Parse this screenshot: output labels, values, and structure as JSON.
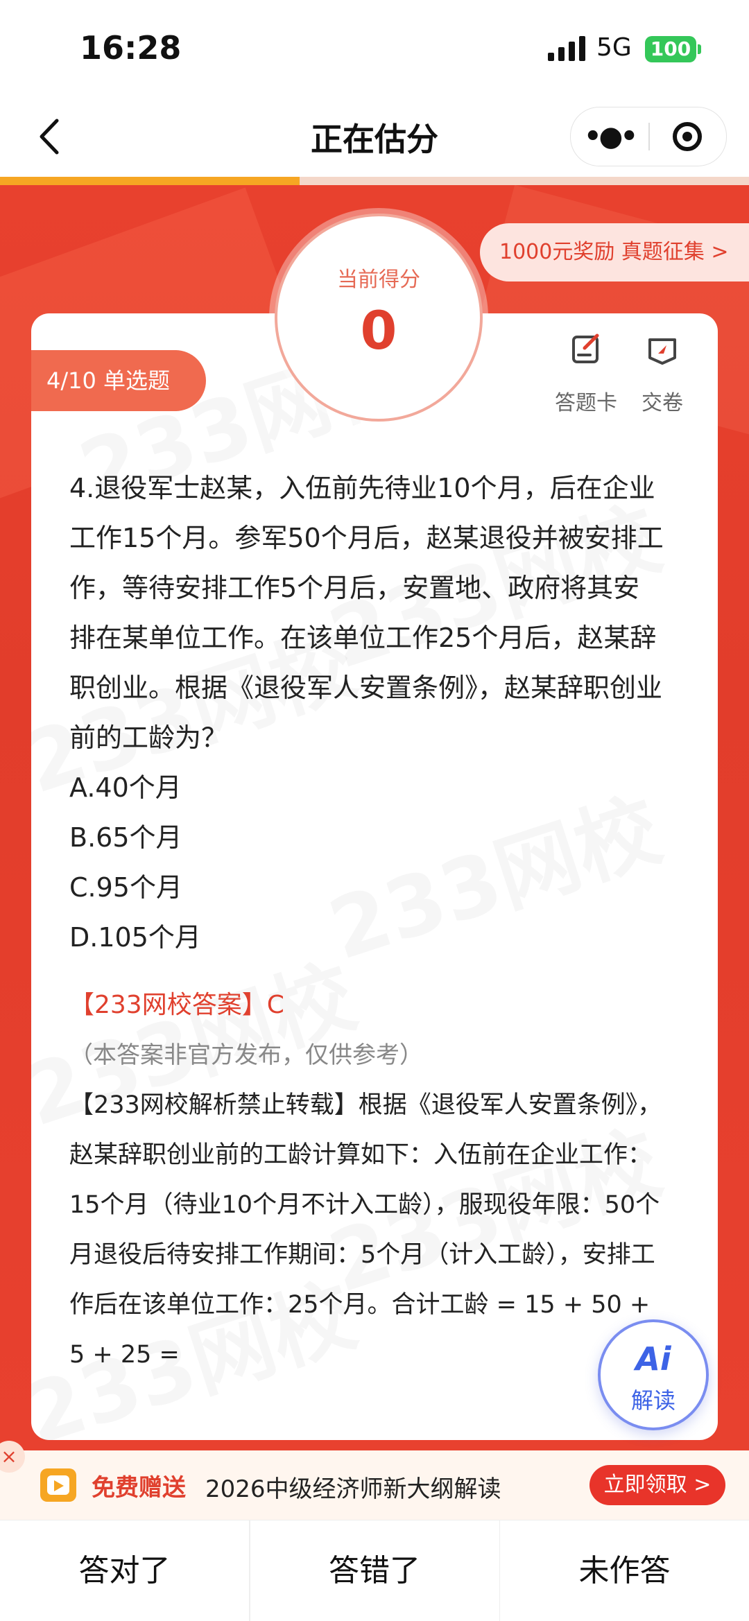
{
  "status_bar": {
    "time": "16:28",
    "network": "5G",
    "battery": "100"
  },
  "nav": {
    "title": "正在估分"
  },
  "progress": {
    "fraction": 0.4
  },
  "reward_banner": "1000元奖励 真题征集 >",
  "question_tag": "4/10 单选题",
  "score": {
    "label": "当前得分",
    "value": "0"
  },
  "tools": [
    {
      "icon": "answer-sheet-icon",
      "label": "答题卡"
    },
    {
      "icon": "submit-icon",
      "label": "交卷"
    }
  ],
  "question": {
    "text": "4.退役军士赵某，入伍前先待业10个月，后在企业工作15个月。参军50个月后，赵某退役并被安排工作，等待安排工作5个月后，安置地、政府将其安排在某单位工作。在该单位工作25个月后，赵某辞职创业。根据《退役军人安置条例》，赵某辞职创业前的工龄为？",
    "options": [
      "A.40个月",
      "B.65个月",
      "C.95个月",
      "D.105个月"
    ],
    "answer": "【233网校答案】C",
    "disclaimer": "（本答案非官方发布，仅供参考）",
    "analysis": "【233网校解析禁止转载】根据《退役军人安置条例》，赵某辞职创业前的工龄计算如下：入伍前在企业工作：15个月（待业10个月不计入工龄），服现役年限：50个月退役后待安排工作期间：5个月（计入工龄），安排工作后在该单位工作：25个月。合计工龄 = 15 + 50 + 5 + 25 ="
  },
  "watermark": "233网校",
  "ai_button": {
    "logo": "Ai",
    "label": "解读"
  },
  "promo": {
    "close": "×",
    "free_label": "免费赠送",
    "text": "2026中级经济师新大纲解读",
    "cta": "立即领取 >"
  },
  "bottom_buttons": [
    "答对了",
    "答错了",
    "未作答"
  ]
}
